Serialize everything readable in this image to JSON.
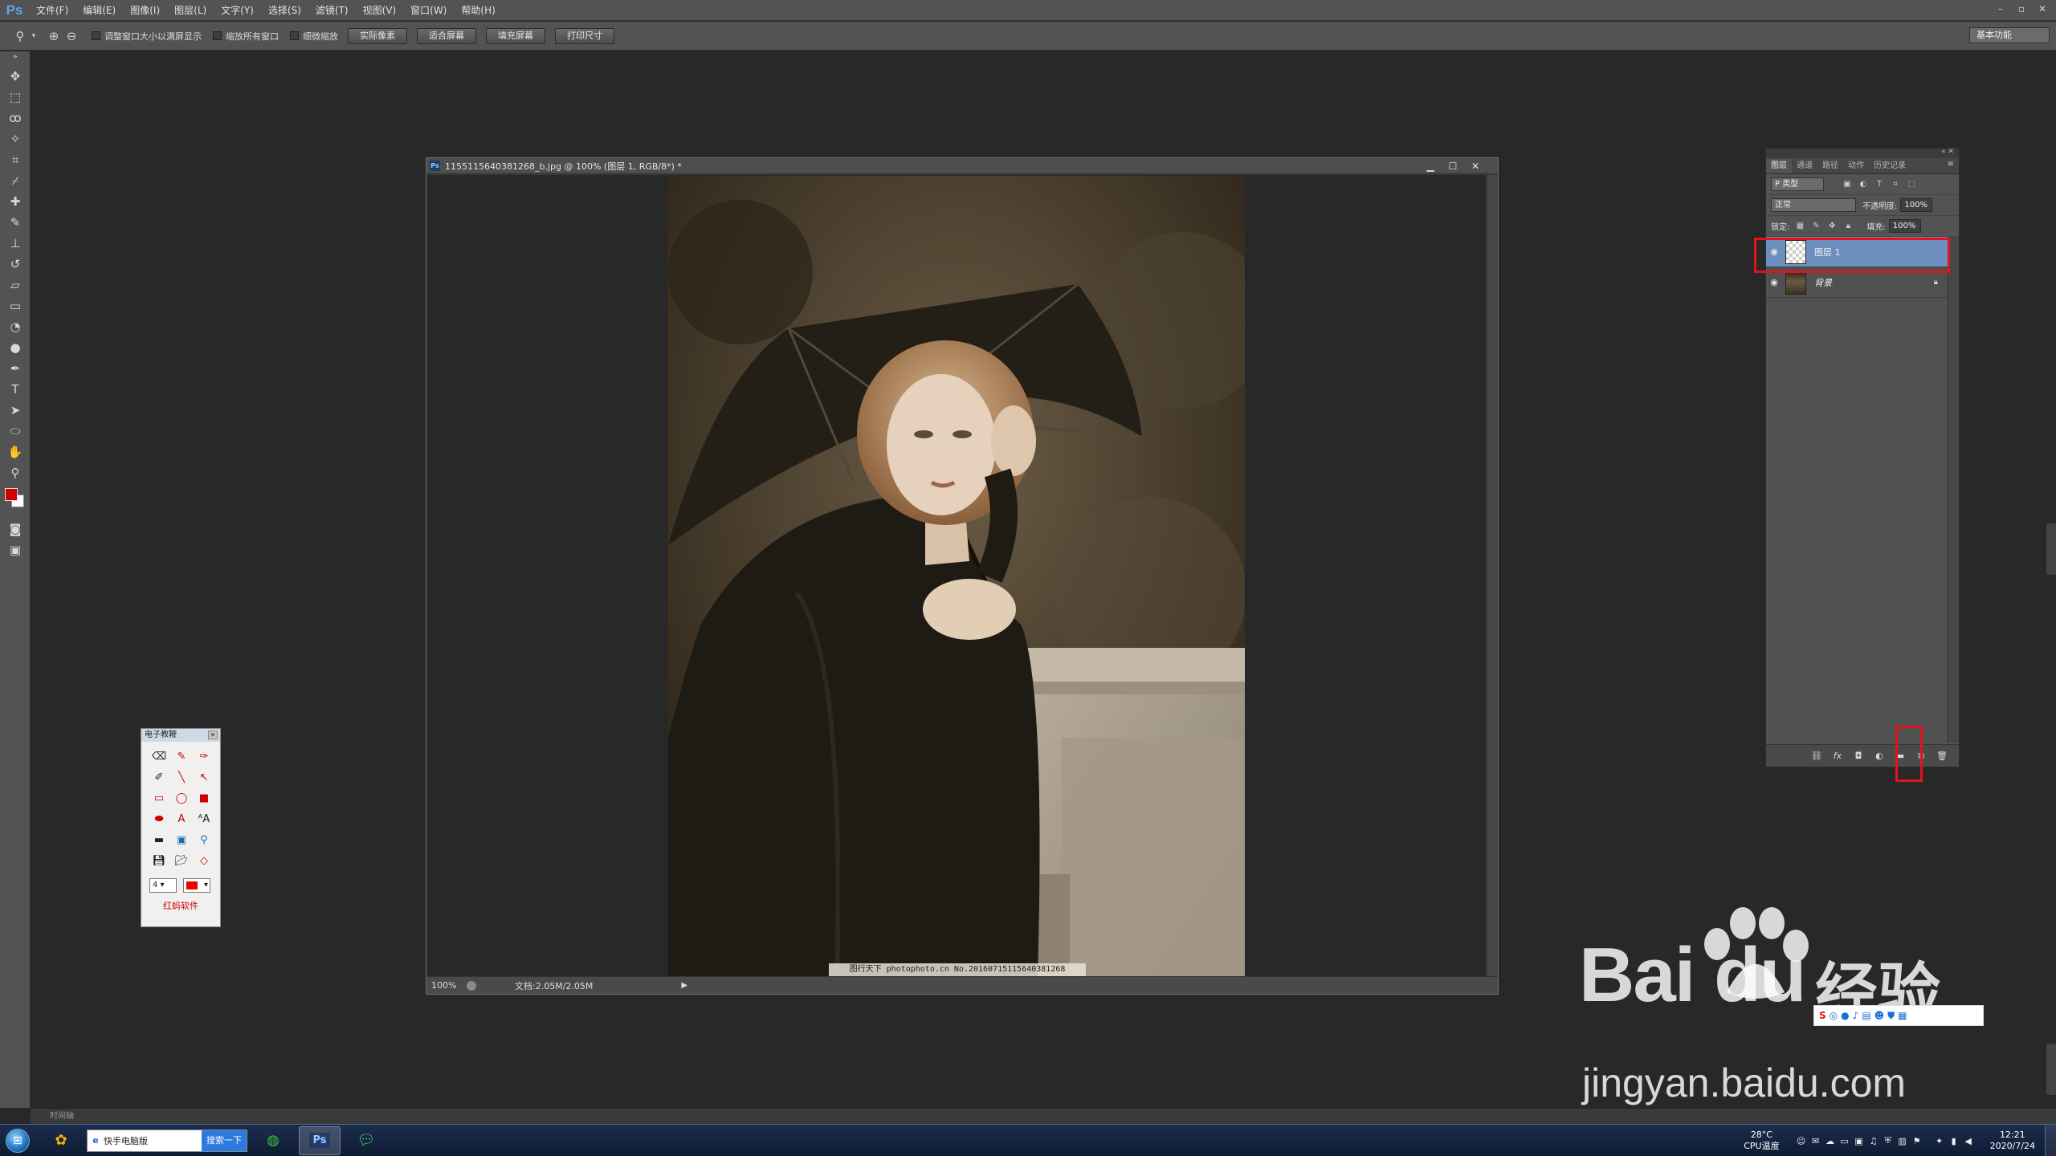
{
  "app": {
    "logo": "Ps",
    "menu": [
      "文件(F)",
      "编辑(E)",
      "图像(I)",
      "图层(L)",
      "文字(Y)",
      "选择(S)",
      "滤镜(T)",
      "视图(V)",
      "窗口(W)",
      "帮助(H)"
    ],
    "window_controls": [
      "–",
      "▫",
      "✕"
    ]
  },
  "options_bar": {
    "checks": [
      "调整窗口大小以满屏显示",
      "缩放所有窗口",
      "细微缩放"
    ],
    "buttons": [
      "实际像素",
      "适合屏幕",
      "填充屏幕",
      "打印尺寸"
    ],
    "workspace": "基本功能"
  },
  "document": {
    "title": "1155115640381268_b.jpg @ 100% (图层 1, RGB/8*) *",
    "zoom": "100%",
    "doc_info": "文档:2.05M/2.05M",
    "watermark": "图行天下 photophoto.cn  No.20160715115640381268"
  },
  "layers_panel": {
    "tabs": [
      "图层",
      "通道",
      "路径",
      "动作",
      "历史记录"
    ],
    "kind_filter": "P 类型",
    "blend_mode": "正常",
    "opacity_label": "不透明度:",
    "opacity_value": "100%",
    "lock_label": "锁定:",
    "fill_label": "填充:",
    "fill_value": "100%",
    "layers": [
      {
        "name": "图层 1",
        "selected": true
      },
      {
        "name": "背景",
        "locked": true
      }
    ]
  },
  "whiteboard": {
    "title": "电子教鞭",
    "size_value": "4",
    "brand": "红蚂软件"
  },
  "timeline": {
    "label": "时间轴"
  },
  "taskbar": {
    "search_text": "快手电脑版",
    "search_button": "搜索一下",
    "temperature": "28°C",
    "cpu_label": "CPU温度",
    "time": "12:21",
    "date": "2020/7/24"
  },
  "baidu": {
    "logo_text": "Bai du",
    "jingyan": "经验",
    "url": "jingyan.baidu.com"
  },
  "colors": {
    "foreground": "#d40000",
    "background": "#ffffff",
    "highlight_box": "#e0141c",
    "selected_layer": "#6b8fbf"
  }
}
